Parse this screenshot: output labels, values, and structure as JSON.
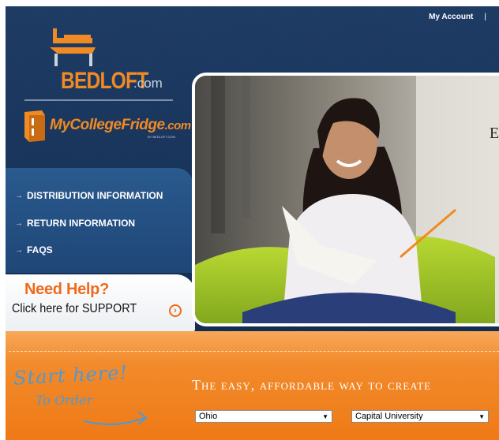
{
  "top_nav": {
    "my_account": "My Account",
    "separator": "|"
  },
  "logos": {
    "bedloft_text": "BEDLOFT",
    "bedloft_com": ".com",
    "fridge_text": "MyCollegeFridge",
    "fridge_com": ".com",
    "fridge_sub": "BY BEDLOFT.COM"
  },
  "side_nav": {
    "items": [
      {
        "label": "DISTRIBUTION INFORMATION",
        "icon": "arrow-right-icon"
      },
      {
        "label": "RETURN INFORMATION",
        "icon": "arrow-right-icon"
      },
      {
        "label": "FAQS",
        "icon": "arrow-right-icon"
      }
    ],
    "arrow_glyph": "→"
  },
  "help": {
    "title": "Need Help?",
    "subtitle": "Click here for SUPPORT",
    "icon": "chevron-circle-right-icon",
    "icon_glyph": "›"
  },
  "hero": {
    "caption": "Ea"
  },
  "order": {
    "start_here": "Start here!",
    "to_order": "To Order",
    "tagline": "The easy, affordable way to create",
    "state_select": {
      "value": "Ohio"
    },
    "school_select": {
      "value": "Capital University"
    },
    "caret_glyph": "▼"
  },
  "colors": {
    "navy": "#1d3a63",
    "orange": "#f08a24",
    "help_orange": "#f06a1a",
    "script_blue": "#4b9ad6"
  }
}
